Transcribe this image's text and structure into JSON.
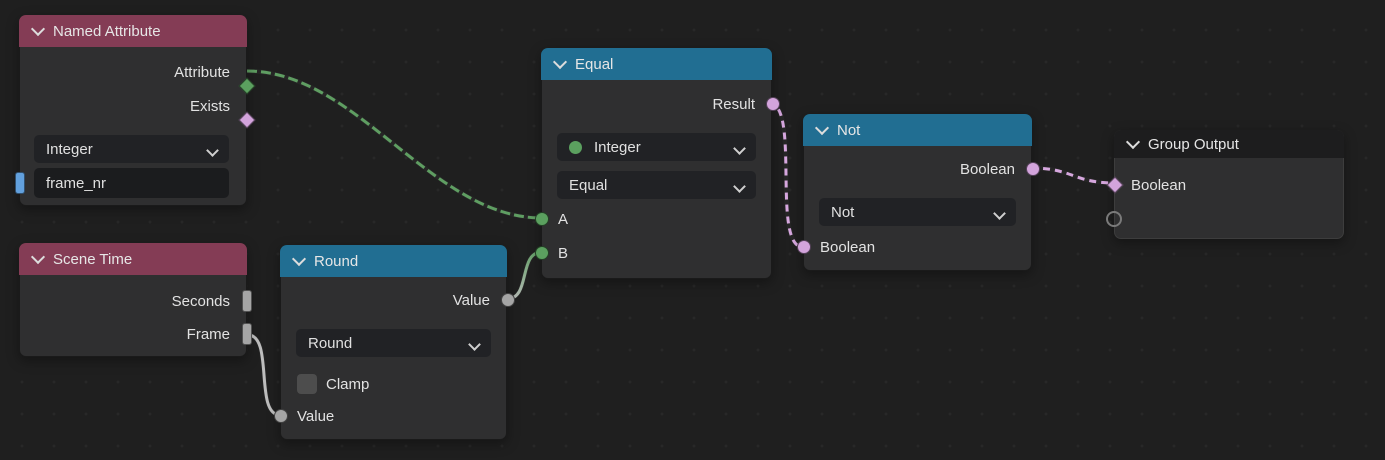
{
  "editor": "node-editor",
  "colors": {
    "bg": "#1f1f1f",
    "dot": "#282828",
    "node_body": "#2f2f30",
    "header_input": "#843c55",
    "header_converter": "#216e92",
    "header_output": "#1d1d1e",
    "widget_bg": "#212225",
    "field_bg": "#1b1c1e",
    "checkbox": "#4d4d4d",
    "socket_green": "#5ba05f",
    "socket_pink": "#d3a4dc",
    "socket_gray": "#a5a5a5",
    "socket_blue": "#62a0dd",
    "socket_virtual": "#7a7a7a",
    "wire_green": "#5f9e62",
    "wire_gray": "#bdbdbd",
    "wire_pink": "#d6a7de",
    "wire_base": "#262626"
  },
  "nodes": {
    "named_attribute": {
      "title": "Named Attribute",
      "output_attribute": "Attribute",
      "output_exists": "Exists",
      "data_type": "Integer",
      "name_value": "frame_nr"
    },
    "scene_time": {
      "title": "Scene Time",
      "output_seconds": "Seconds",
      "output_frame": "Frame"
    },
    "round": {
      "title": "Round",
      "output_value": "Value",
      "operation": "Round",
      "clamp_label": "Clamp",
      "input_value": "Value"
    },
    "equal": {
      "title": "Equal",
      "output_result": "Result",
      "data_type": "Integer",
      "operation": "Equal",
      "input_a": "A",
      "input_b": "B"
    },
    "not": {
      "title": "Not",
      "output_boolean": "Boolean",
      "operation": "Not",
      "input_boolean": "Boolean"
    },
    "group_output": {
      "title": "Group Output",
      "input_boolean": "Boolean"
    }
  },
  "links": [
    {
      "from": "Named Attribute.Attribute",
      "to": "Equal.A",
      "color": "green",
      "style": "dashed"
    },
    {
      "from": "Scene Time.Frame",
      "to": "Round.Value",
      "color": "gray",
      "style": "solid"
    },
    {
      "from": "Round.Value",
      "to": "Equal.B",
      "color": "gray-to-green",
      "style": "solid"
    },
    {
      "from": "Equal.Result",
      "to": "Not.Boolean",
      "color": "pink",
      "style": "dashed"
    },
    {
      "from": "Not.Boolean",
      "to": "Group Output.Boolean",
      "color": "pink",
      "style": "dashed"
    }
  ]
}
